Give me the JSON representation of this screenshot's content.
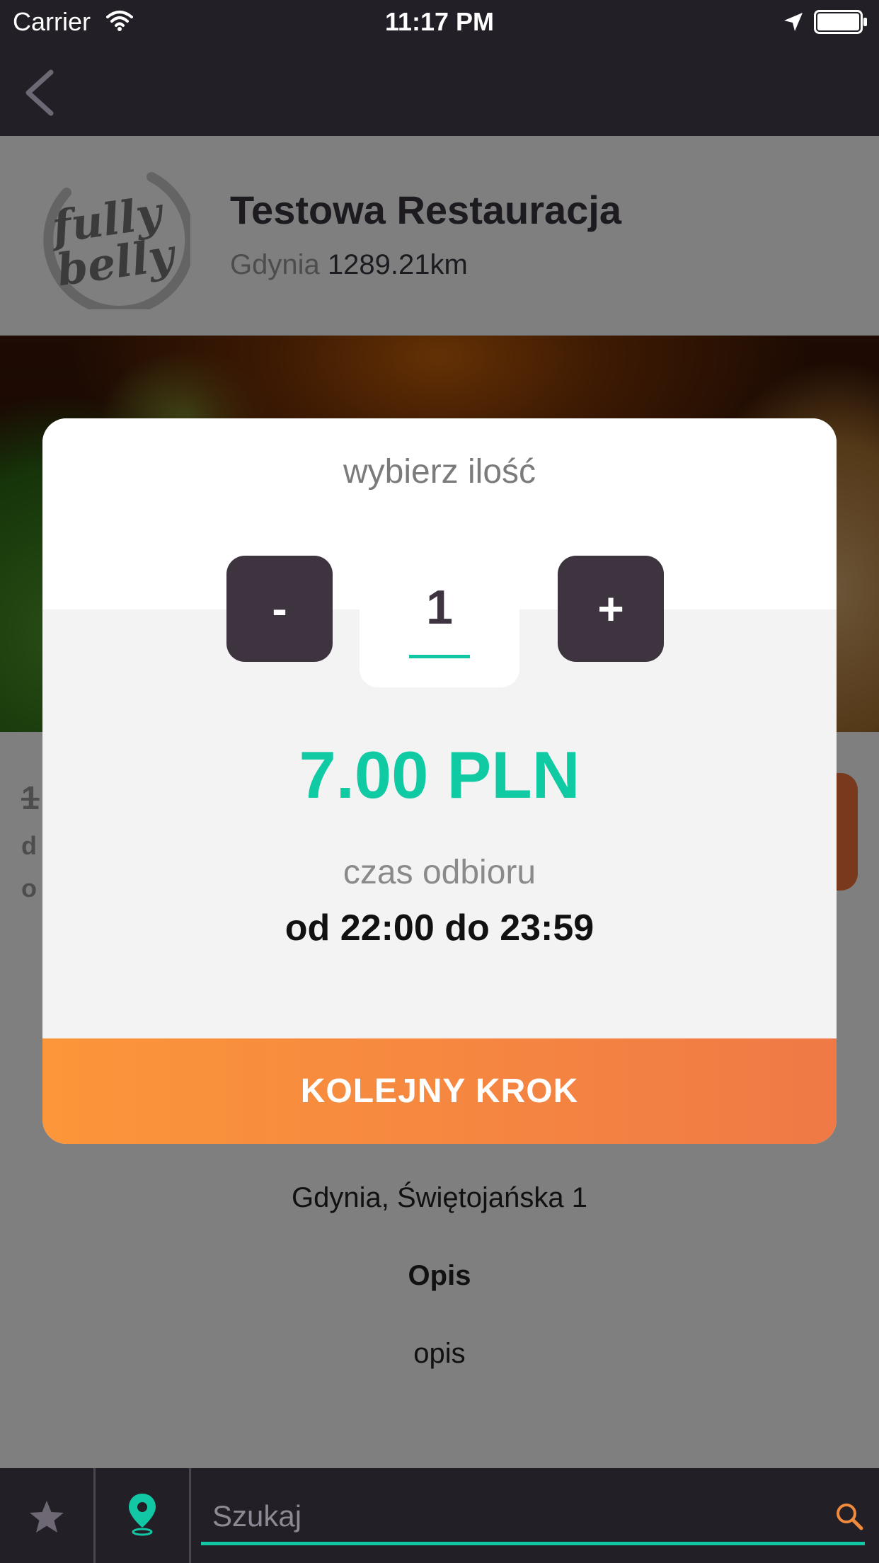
{
  "status_bar": {
    "carrier": "Carrier",
    "time": "11:17 PM",
    "icons": [
      "wifi-icon",
      "location-arrow-icon",
      "battery-icon"
    ]
  },
  "nav": {
    "back_icon": "chevron-left-icon"
  },
  "restaurant": {
    "logo_text": "fully belly",
    "name": "Testowa Restauracja",
    "city": "Gdynia",
    "distance": "1289.21km"
  },
  "product": {
    "old_price": "1",
    "detail_line_1": "d",
    "detail_line_2": "o",
    "address": "Gdynia, Świętojańska 1",
    "description_heading": "Opis",
    "description_text": "opis"
  },
  "modal": {
    "title": "wybierz ilość",
    "minus_label": "-",
    "plus_label": "+",
    "quantity": "1",
    "price": "7.00 PLN",
    "pickup_label": "czas odbioru",
    "pickup_time": "od 22:00 do 23:59",
    "next_button": "KOLEJNY KROK"
  },
  "bottom_bar": {
    "icons": [
      "star-icon",
      "map-pin-icon",
      "search-icon"
    ],
    "search_placeholder": "Szukaj",
    "search_value": ""
  },
  "colors": {
    "dark_bar": "#231f26",
    "accent_teal": "#0fcaa3",
    "button_dark": "#3d3440",
    "orange_start": "#fb963a",
    "orange_end": "#f07946",
    "search_icon": "#f08a3c"
  }
}
